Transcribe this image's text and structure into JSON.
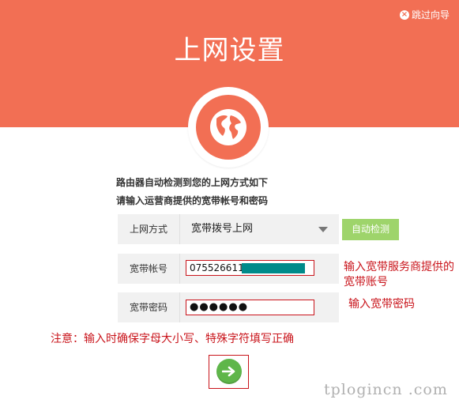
{
  "header": {
    "title": "上网设置",
    "skip_label": "跳过向导",
    "color": "#f26f54"
  },
  "icons": {
    "globe": "globe-icon",
    "skip": "close-circle-icon",
    "next": "arrow-right-icon",
    "dropdown": "chevron-down-icon"
  },
  "description": {
    "line1": "路由器自动检测到您的上网方式如下",
    "line2": "请输入运营商提供的宽带帐号和密码"
  },
  "form": {
    "connection_type": {
      "label": "上网方式",
      "value": "宽带拨号上网",
      "detect_button": "自动检测"
    },
    "account": {
      "label": "宽带帐号",
      "value": "075526611"
    },
    "password": {
      "label": "宽带密码",
      "value": "●●●●●●"
    }
  },
  "annotations": {
    "account_note": "输入宽带服务商提供的宽带账号",
    "password_note": "输入宽带密码",
    "warning": "注意：输入时确保字母大小写、特殊字符填写正确"
  },
  "watermark": "tplogincn .com",
  "colors": {
    "accent": "#f26f54",
    "detect_button": "#9ed46b",
    "next_button": "#5fb64a",
    "annotation": "#c9141b"
  }
}
